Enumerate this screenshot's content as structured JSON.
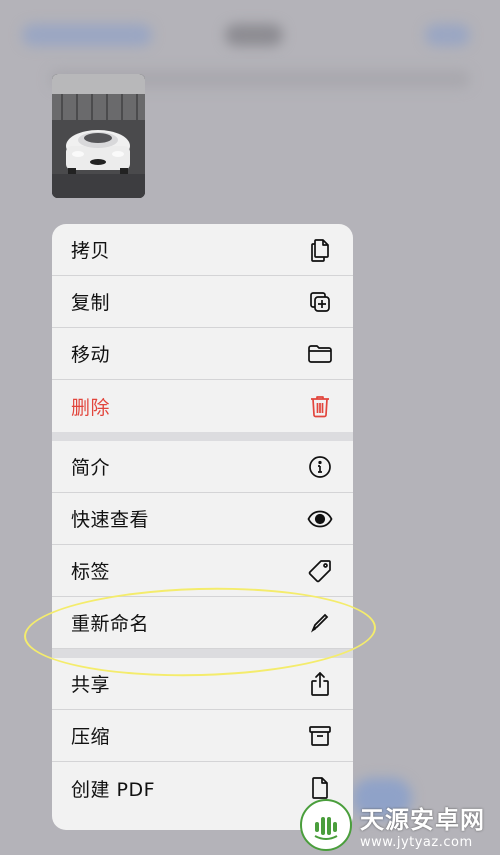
{
  "menu": {
    "items": [
      {
        "label": "拷贝",
        "icon": "copy-documents-icon"
      },
      {
        "label": "复制",
        "icon": "duplicate-plus-icon"
      },
      {
        "label": "移动",
        "icon": "folder-icon"
      },
      {
        "label": "删除",
        "icon": "trash-icon",
        "destructive": true
      },
      {
        "label": "简介",
        "icon": "info-circle-icon"
      },
      {
        "label": "快速查看",
        "icon": "eye-icon"
      },
      {
        "label": "标签",
        "icon": "tag-icon"
      },
      {
        "label": "重新命名",
        "icon": "pencil-icon"
      },
      {
        "label": "共享",
        "icon": "share-icon"
      },
      {
        "label": "压缩",
        "icon": "archive-box-icon"
      },
      {
        "label": "创建 PDF",
        "icon": "document-icon"
      }
    ]
  },
  "watermark": {
    "title": "天源安卓网",
    "url": "www.jytyaz.com"
  },
  "colors": {
    "destructive": "#e2453c",
    "highlight": "#f4ec6c",
    "menu_background": "#f2f2f2",
    "backdrop": "#b4b3b9"
  }
}
